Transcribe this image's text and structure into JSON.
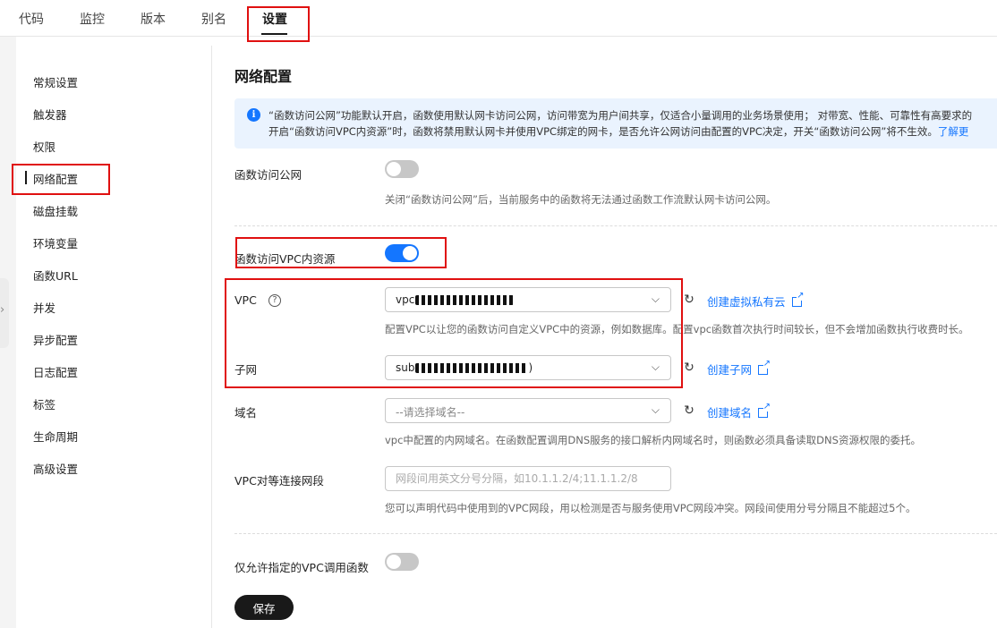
{
  "top_tabs": [
    {
      "label": "代码"
    },
    {
      "label": "监控"
    },
    {
      "label": "版本"
    },
    {
      "label": "别名"
    },
    {
      "label": "设置"
    }
  ],
  "sidebar": {
    "items": [
      {
        "label": "常规设置"
      },
      {
        "label": "触发器"
      },
      {
        "label": "权限"
      },
      {
        "label": "网络配置"
      },
      {
        "label": "磁盘挂载"
      },
      {
        "label": "环境变量"
      },
      {
        "label": "函数URL"
      },
      {
        "label": "并发"
      },
      {
        "label": "异步配置"
      },
      {
        "label": "日志配置"
      },
      {
        "label": "标签"
      },
      {
        "label": "生命周期"
      },
      {
        "label": "高级设置"
      }
    ]
  },
  "main": {
    "title": "网络配置",
    "info": {
      "line1": "“函数访问公网”功能默认开启，函数使用默认网卡访问公网，访问带宽为用户间共享，仅适合小量调用的业务场景使用； 对带宽、性能、可靠性有高要求的",
      "line2": "开启“函数访问VPC内资源”时，函数将禁用默认网卡并使用VPC绑定的网卡，是否允许公网访问由配置的VPC决定，开关“函数访问公网”将不生效。",
      "link": "了解更"
    },
    "public_access": {
      "label": "函数访问公网",
      "enabled": false,
      "hint": "关闭“函数访问公网”后，当前服务中的函数将无法通过函数工作流默认网卡访问公网。"
    },
    "vpc_access": {
      "label": "函数访问VPC内资源",
      "enabled": true
    },
    "vpc": {
      "label": "VPC",
      "help_icon": "?",
      "value_prefix": "vpc",
      "value_suffix": "",
      "link": "创建虚拟私有云",
      "hint": "配置VPC以让您的函数访问自定义VPC中的资源，例如数据库。配置vpc函数首次执行时间较长，但不会增加函数执行收费时长。"
    },
    "subnet": {
      "label": "子网",
      "value_prefix": "sub",
      "value_suffix": ")",
      "link": "创建子网"
    },
    "domain": {
      "label": "域名",
      "placeholder": "--请选择域名--",
      "link": "创建域名",
      "hint": "vpc中配置的内网域名。在函数配置调用DNS服务的接口解析内网域名时，则函数必须具备读取DNS资源权限的委托。"
    },
    "peering": {
      "label": "VPC对等连接网段",
      "placeholder": "网段间用英文分号分隔，如10.1.1.2/4;11.1.1.2/8",
      "hint": "您可以声明代码中使用到的VPC网段，用以检测是否与服务使用VPC网段冲突。网段间使用分号分隔且不能超过5个。"
    },
    "restrict": {
      "label": "仅允许指定的VPC调用函数",
      "enabled": false
    },
    "save_label": "保存"
  },
  "colors": {
    "accent": "#1476ff",
    "highlight_box": "#e01010",
    "info_bg": "#eaf3fe"
  }
}
